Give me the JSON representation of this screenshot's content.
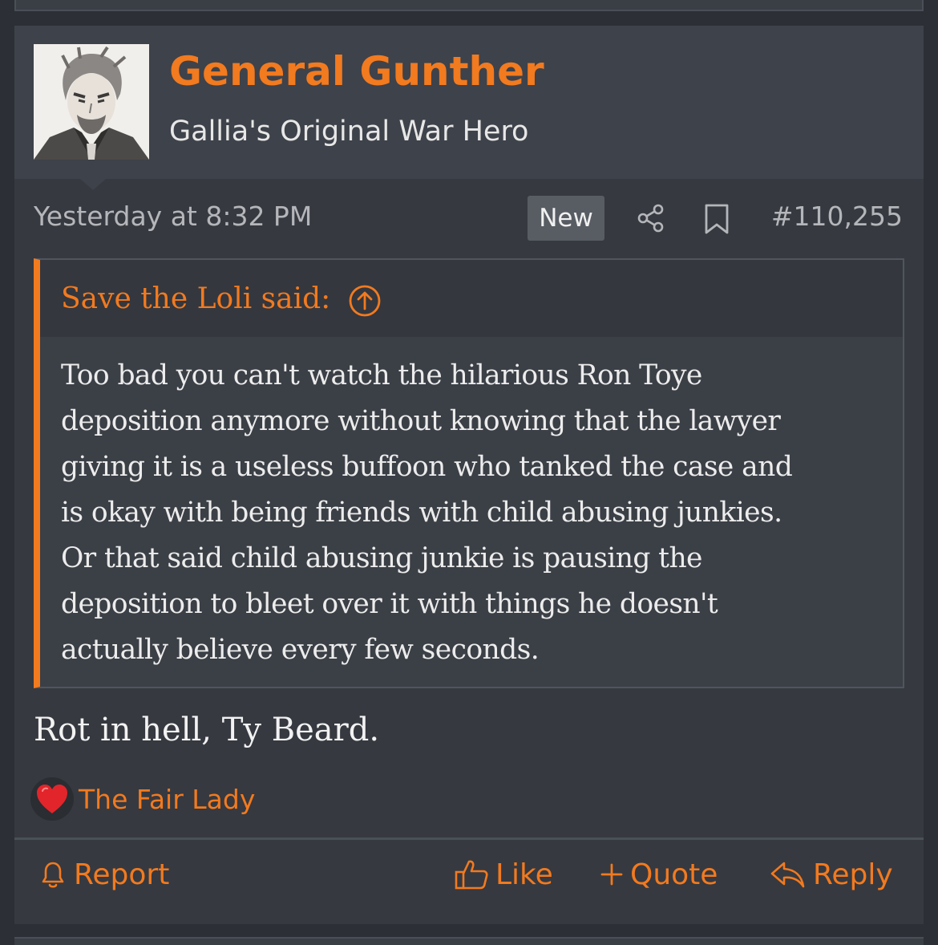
{
  "colors": {
    "accent": "#f27a1f",
    "post_background": "#363940",
    "header_background": "#3e424a",
    "heart": "#e2252b"
  },
  "post": {
    "author": {
      "avatar_icon": "avatar-portrait",
      "name": "General Gunther",
      "title": "Gallia's Original War Hero"
    },
    "meta": {
      "date": "Yesterday at 8:32 PM",
      "badge": "New",
      "share_icon": "share-icon",
      "bookmark_icon": "bookmark-icon",
      "post_number": "#110,255"
    },
    "quote": {
      "author_label": "Save the Loli said:",
      "jump_icon": "arrow-up-circle-icon",
      "lines": [
        "Too bad you can't watch the hilarious Ron Toye",
        "deposition anymore without knowing that the lawyer",
        "giving it is a useless buffoon who tanked the case and",
        "is okay with being friends with child abusing junkies.",
        "Or that said child abusing junkie is pausing the",
        "deposition to bleet over it with things he doesn't",
        "actually believe every few seconds."
      ]
    },
    "message": "Rot in hell, Ty Beard.",
    "reaction": {
      "icon": "heart-icon",
      "user": "The Fair Lady"
    },
    "actions": {
      "report": "Report",
      "like": "Like",
      "quote": "Quote",
      "reply": "Reply"
    }
  }
}
